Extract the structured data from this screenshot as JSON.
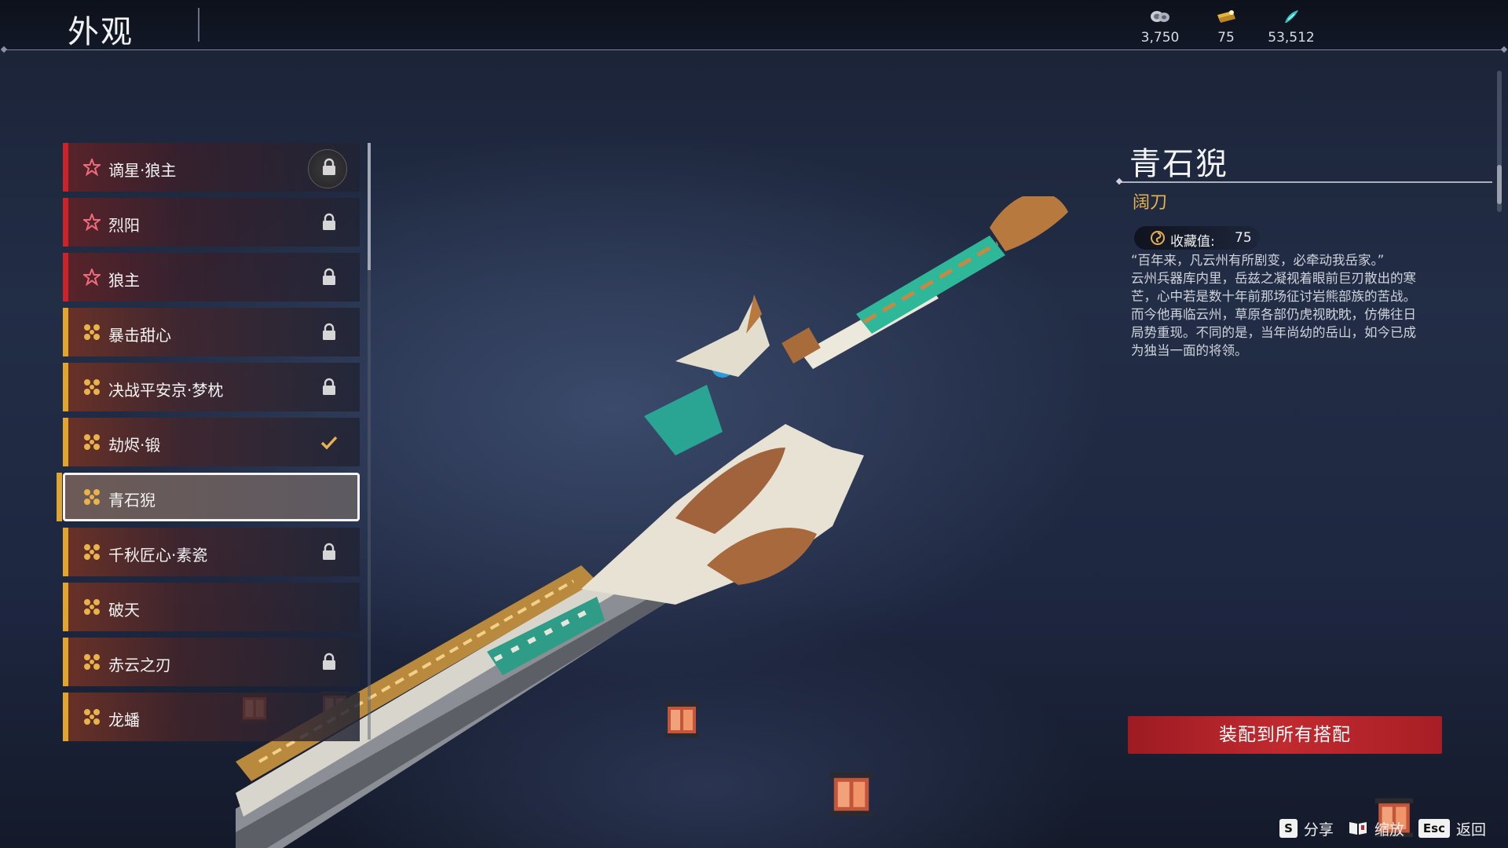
{
  "header": {
    "title": "外观",
    "currencies": [
      {
        "icon": "coin-pile-icon",
        "value": "3,750"
      },
      {
        "icon": "gold-ticket-icon",
        "value": "75"
      },
      {
        "icon": "jade-feather-icon",
        "value": "53,512"
      }
    ]
  },
  "skins": [
    {
      "name": "谪星·狼主",
      "rank": "red",
      "status": "locked-badge"
    },
    {
      "name": "烈阳",
      "rank": "red",
      "status": "locked"
    },
    {
      "name": "狼主",
      "rank": "red",
      "status": "locked"
    },
    {
      "name": "暴击甜心",
      "rank": "gold",
      "status": "locked"
    },
    {
      "name": "决战平安京·梦枕",
      "rank": "gold",
      "status": "locked"
    },
    {
      "name": "劫烬·锻",
      "rank": "gold",
      "status": "equipped"
    },
    {
      "name": "青石猊",
      "rank": "gold",
      "status": "selected"
    },
    {
      "name": "千秋匠心·素瓷",
      "rank": "gold",
      "status": "locked"
    },
    {
      "name": "破天",
      "rank": "gold",
      "status": "none"
    },
    {
      "name": "赤云之刃",
      "rank": "gold",
      "status": "locked"
    },
    {
      "name": "龙蟠",
      "rank": "gold",
      "status": "none"
    }
  ],
  "detail": {
    "name": "青石猊",
    "type": "阔刀",
    "collect_label": "收藏值:",
    "collect_value": "75",
    "description": [
      "“百年来，凡云州有所剧变，必牵动我岳家。”",
      "云州兵器库内里，岳兹之凝视着眼前巨刃散出的寒",
      "芒，心中若是数十年前那场征讨岩熊部族的苦战。",
      "而今他再临云州，草原各部仍虎视眈眈，仿佛往日",
      "局势重现。不同的是，当年尚幼的岳山，如今已成",
      "为独当一面的将领。"
    ]
  },
  "equip_button": "装配到所有搭配",
  "hints": [
    {
      "key": "S",
      "label": "分享",
      "icon": ""
    },
    {
      "key": "",
      "label": "缩放",
      "icon": "book-icon"
    },
    {
      "key": "Esc",
      "label": "返回",
      "icon": ""
    }
  ],
  "colors": {
    "rank_red": "#c8242a",
    "rank_gold": "#e0a431",
    "accent_gold_text": "#e7b24f",
    "equip_button": "#b0242a"
  }
}
